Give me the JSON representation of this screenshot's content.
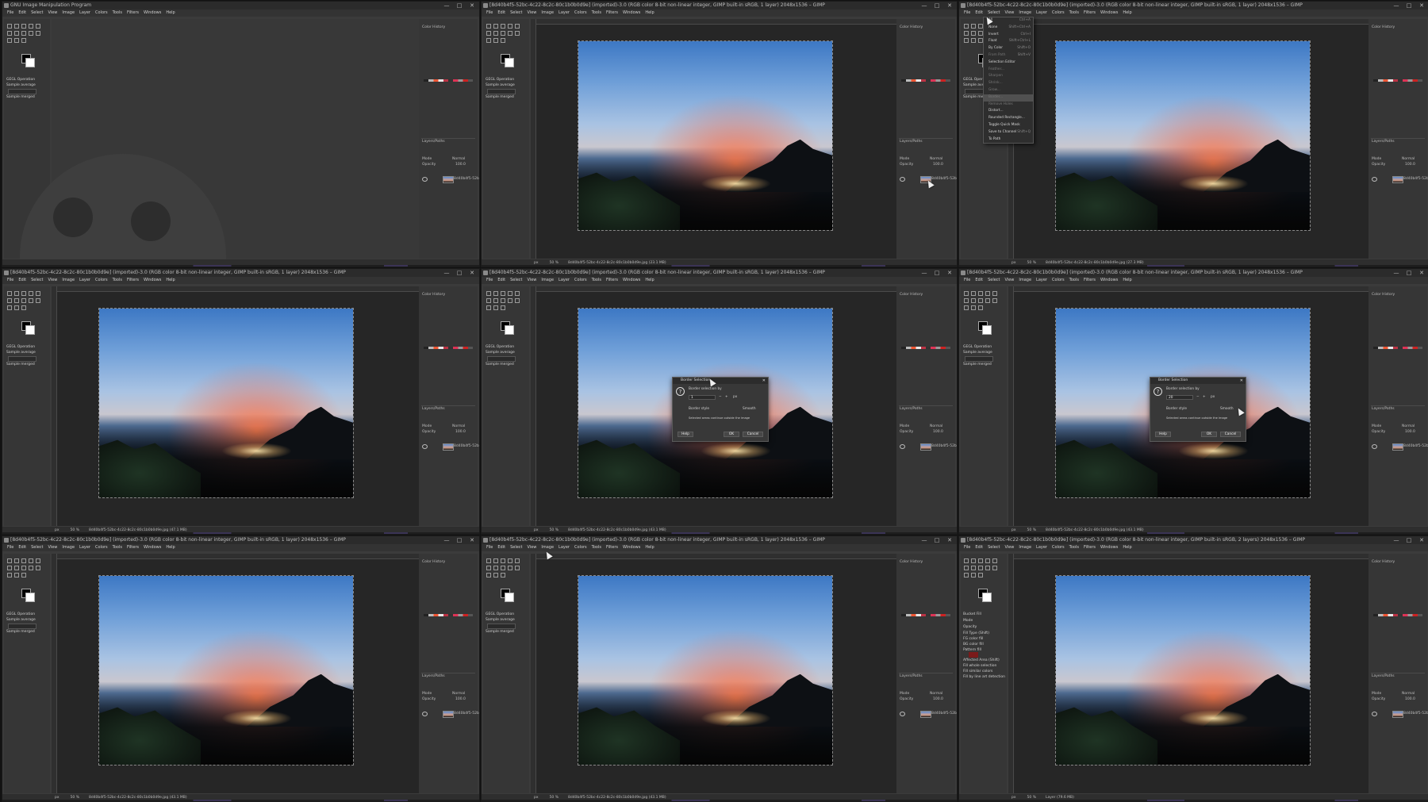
{
  "windows": [
    {
      "id": "w1",
      "title": "GNU Image Manipulation Program",
      "empty": true,
      "status": "",
      "zoom": ""
    },
    {
      "id": "w2",
      "title": "[8d40b4f5-52bc-4c22-8c2c-80c1b0b0d9e] (imported)-3.0 (RGB color 8-bit non-linear integer, GIMP built-in sRGB, 1 layer) 2048x1536 – GIMP",
      "status": "px",
      "zoom": "50 %",
      "image_name": "8d40b4f5-52bc-4c22-8c2c-80c1b0b0d9e.jpg (23.1 MB)"
    },
    {
      "id": "w3",
      "title": "[8d40b4f5-52bc-4c22-8c2c-80c1b0b0d9e] (imported)-3.0 (RGB color 8-bit non-linear integer, GIMP built-in sRGB, 1 layer) 2048x1536 – GIMP",
      "status": "px",
      "zoom": "50 %",
      "image_name": "8d40b4f5-52bc-4c22-8c2c-80c1b0b0d9e.jpg (27.3 MB)"
    },
    {
      "id": "w4",
      "title": "[8d40b4f5-52bc-4c22-8c2c-80c1b0b0d9e] (imported)-3.0 (RGB color 8-bit non-linear integer, GIMP built-in sRGB, 1 layer) 2048x1536 – GIMP",
      "status": "px",
      "zoom": "50 %",
      "image_name": "8d40b4f5-52bc-4c22-8c2c-80c1b0b0d9e.jpg (47.1 MB)"
    },
    {
      "id": "w5",
      "title": "[8d40b4f5-52bc-4c22-8c2c-80c1b0b0d9e] (imported)-3.0 (RGB color 8-bit non-linear integer, GIMP built-in sRGB, 1 layer) 2048x1536 – GIMP",
      "status": "px",
      "zoom": "50 %",
      "image_name": "8d40b4f5-52bc-4c22-8c2c-80c1b0b0d9e.jpg (43.1 MB)"
    },
    {
      "id": "w6",
      "title": "[8d40b4f5-52bc-4c22-8c2c-80c1b0b0d9e] (imported)-3.0 (RGB color 8-bit non-linear integer, GIMP built-in sRGB, 1 layer) 2048x1536 – GIMP",
      "status": "px",
      "zoom": "50 %",
      "image_name": "8d40b4f5-52bc-4c22-8c2c-80c1b0b0d9e.jpg (43.1 MB)"
    },
    {
      "id": "w7",
      "title": "[8d40b4f5-52bc-4c22-8c2c-80c1b0b0d9e] (imported)-3.0 (RGB color 8-bit non-linear integer, GIMP built-in sRGB, 1 layer) 2048x1536 – GIMP",
      "status": "px",
      "zoom": "50 %",
      "image_name": "8d40b4f5-52bc-4c22-8c2c-80c1b0b0d9e.jpg (43.1 MB)"
    },
    {
      "id": "w8",
      "title": "[8d40b4f5-52bc-4c22-8c2c-80c1b0b0d9e] (imported)-3.0 (RGB color 8-bit non-linear integer, GIMP built-in sRGB, 1 layer) 2048x1536 – GIMP",
      "status": "px",
      "zoom": "50 %",
      "image_name": "8d40b4f5-52bc-4c22-8c2c-80c1b0b0d9e.jpg (43.1 MB)"
    },
    {
      "id": "w9",
      "title": "[8d40b4f5-52bc-4c22-8c2c-80c1b0b0d9e] (imported)-3.0 (RGB color 8-bit non-linear integer, GIMP built-in sRGB, 2 layers) 2048x1536 – GIMP",
      "status": "px",
      "zoom": "50 %",
      "image_name": "Layer (79.6 MB)"
    }
  ],
  "menubar": [
    "File",
    "Edit",
    "Select",
    "View",
    "Image",
    "Layer",
    "Colors",
    "Tools",
    "Filters",
    "Windows",
    "Help"
  ],
  "tool_options": {
    "title": "GEGL Operation",
    "sample_average": "Sample average",
    "sample_merged": "Sample merged"
  },
  "bucket_options": {
    "title": "Bucket Fill",
    "mode": "Mode",
    "mode_value": "Normal",
    "opacity": "Opacity",
    "fill_type": "Fill Type (Shift)",
    "fg_fill": "FG color fill",
    "bg_fill": "BG color fill",
    "pattern_fill": "Pattern fill",
    "affected_area": "Affected Area (Shift)",
    "fill_whole": "Fill whole selection",
    "fill_similar": "Fill similar colors",
    "fill_line_art": "Fill by line art detection"
  },
  "dock": {
    "color_history": "Color History",
    "layers_tab": "Layers/Paths",
    "mode_label": "Mode",
    "mode_value": "Normal",
    "opacity_label": "Opacity",
    "opacity_value": "100.0",
    "layer_name": "8d40b4f5-52bc-4..."
  },
  "select_menu": {
    "items": [
      "All",
      "None",
      "Invert",
      "Float",
      "By Color",
      "From Path",
      "Selection Editor",
      "Feather...",
      "Sharpen",
      "Shrink...",
      "Grow...",
      "Border...",
      "Remove Holes",
      "Distort...",
      "Rounded Rectangle...",
      "Toggle Quick Mask",
      "Save to Channel",
      "To Path"
    ],
    "shortcuts": [
      "Ctrl+A",
      "Shift+Ctrl+A",
      "Ctrl+I",
      "Shift+Ctrl+L",
      "Shift+O",
      "Shift+V",
      "",
      "",
      "",
      "",
      "",
      "",
      "",
      "",
      "",
      "Shift+Q",
      "",
      ""
    ]
  },
  "border_dialog": {
    "title": "Border Selection",
    "prompt": "Border selection by",
    "value_a": "1",
    "value_b": "20",
    "unit": "px",
    "style_label": "Border style",
    "style_value": "Smooth",
    "checkbox": "Selected areas continue outside the image",
    "help": "Help",
    "ok": "OK",
    "cancel": "Cancel"
  }
}
